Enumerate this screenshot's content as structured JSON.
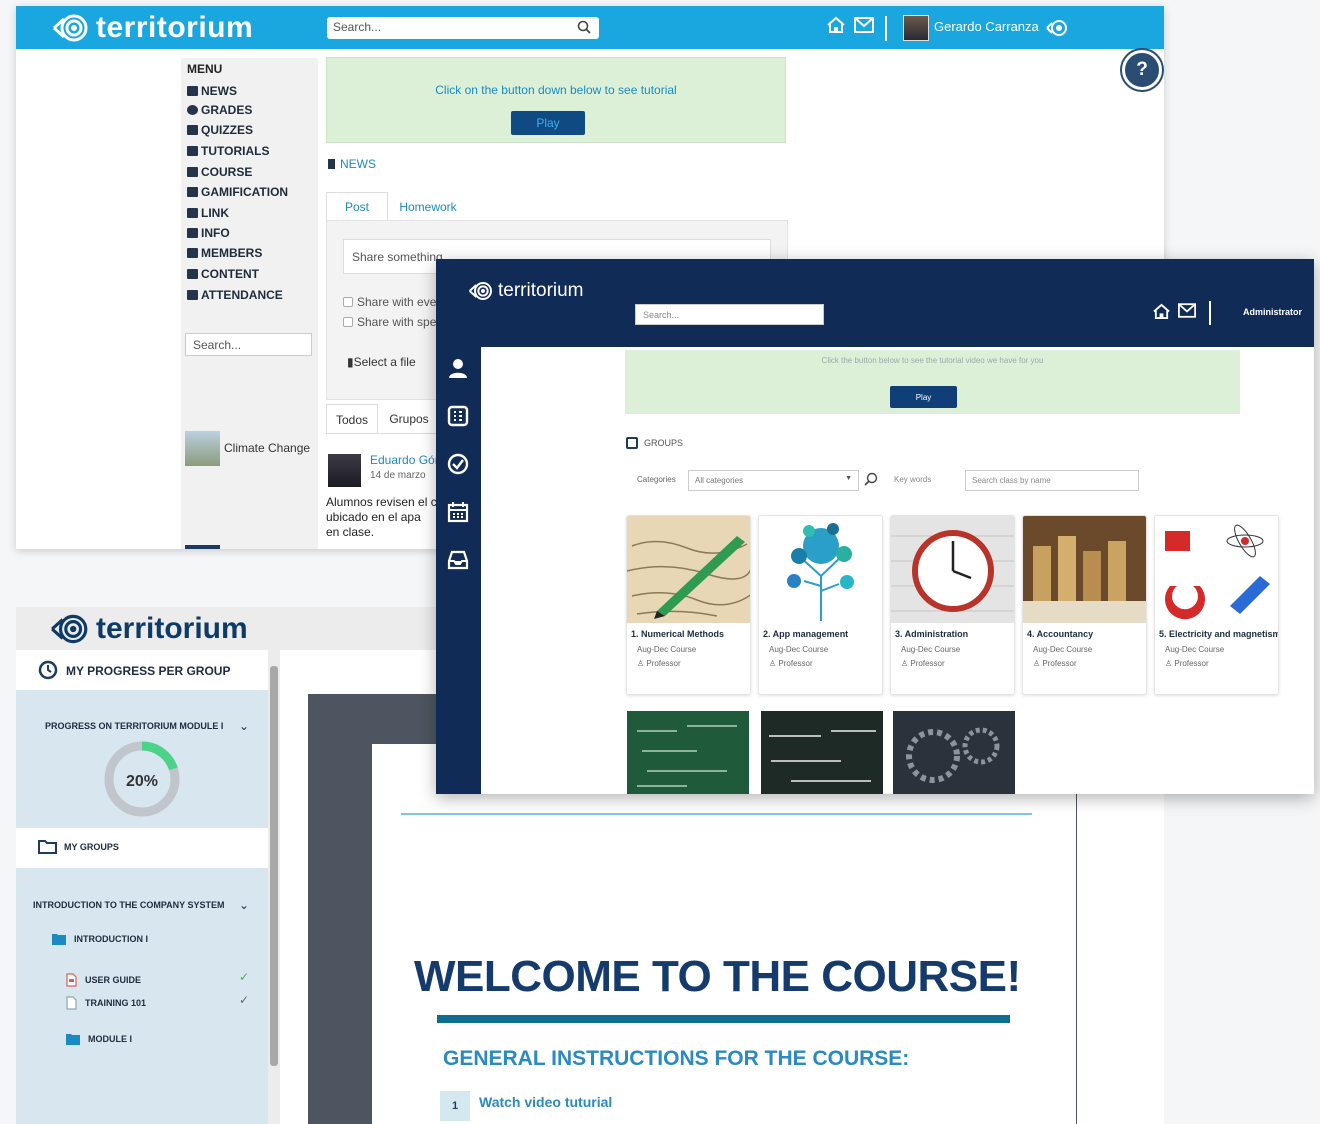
{
  "window_main": {
    "logo_text": "territorium",
    "search_placeholder": "Search...",
    "user_name": "Gerardo Carranza",
    "help_label": "?",
    "menu": {
      "title": "MENU",
      "items": [
        {
          "label": "NEWS",
          "icon": "newspaper-icon"
        },
        {
          "label": "GRADES",
          "icon": "check-circle-icon"
        },
        {
          "label": "QUIZZES",
          "icon": "bookmark-icon"
        },
        {
          "label": "TUTORIALS",
          "icon": "play-square-icon"
        },
        {
          "label": "COURSE",
          "icon": "book-icon"
        },
        {
          "label": "GAMIFICATION",
          "icon": "trophy-icon"
        },
        {
          "label": "LINK",
          "icon": "link-icon"
        },
        {
          "label": "INFO",
          "icon": "image-icon"
        },
        {
          "label": "MEMBERS",
          "icon": "members-icon"
        },
        {
          "label": "CONTENT",
          "icon": "content-icon"
        },
        {
          "label": "ATTENDANCE",
          "icon": "attendance-icon"
        }
      ],
      "search_placeholder": "Search...",
      "featured_label": "Climate Change"
    },
    "tutorial": {
      "text": "Click on the button down below to see tutorial",
      "button": "Play"
    },
    "news_heading": "NEWS",
    "tabs": [
      "Post",
      "Homework"
    ],
    "share_placeholder": "Share something",
    "share_options": [
      "Share with eve",
      "Share with spe"
    ],
    "file_label": "Select a file",
    "feed_tabs": [
      "Todos",
      "Grupos"
    ],
    "post": {
      "author": "Eduardo Gón",
      "date": "14 de marzo",
      "text_lines": [
        "Alumnos revisen el c",
        "ubicado en el apa",
        "en clase."
      ]
    }
  },
  "window_progress": {
    "logo_text": "territorium",
    "progress_heading": "MY PROGRESS PER GROUP",
    "module_title": "PROGRESS ON TERRITORIUM MODULE I",
    "progress_percent": 20,
    "progress_label": "20%",
    "groups_heading": "MY GROUPS",
    "course_title": "INTRODUCTION TO THE COMPANY SYSTEM",
    "intro_folder": "INTRODUCTION I",
    "files": [
      {
        "label": "USER GUIDE",
        "done": true,
        "check_color": "#4caf50"
      },
      {
        "label": "TRAINING 101",
        "done": true,
        "check_color": "#666666"
      }
    ],
    "module_folder": "MODULE I",
    "welcome_title": "WELCOME TO THE COURSE!",
    "instructions_heading": "GENERAL INSTRUCTIONS FOR THE COURSE:",
    "steps": [
      {
        "number": "1",
        "label": "Watch video tuturial"
      }
    ]
  },
  "window_groups": {
    "logo_text": "territorium",
    "search_placeholder": "Search...",
    "user_label": "Administrator",
    "tutorial": {
      "text": "Click the button below to see the tutorial video we have for you",
      "button": "Play"
    },
    "groups_heading": "GROUPS",
    "categories_label": "Categories",
    "categories_value": "All categories",
    "keywords_label": "Key words",
    "keywords_placeholder": "Search class by name",
    "courses": [
      {
        "title": "1. Numerical Methods",
        "subtitle": "Aug-Dec Course",
        "role": "Professor"
      },
      {
        "title": "2. App management",
        "subtitle": "Aug-Dec Course",
        "role": "Professor"
      },
      {
        "title": "3. Administration",
        "subtitle": "Aug-Dec Course",
        "role": "Professor"
      },
      {
        "title": "4. Accountancy",
        "subtitle": "Aug-Dec Course",
        "role": "Professor"
      },
      {
        "title": "5. Electricity and magnetism",
        "subtitle": "Aug-Dec Course",
        "role": "Professor"
      }
    ],
    "rail_icons": [
      "user-icon",
      "grades-icon",
      "check-icon",
      "calendar-icon",
      "inbox-icon"
    ]
  },
  "colors": {
    "main_header": "#1aa6de",
    "navy_header": "#0f2b56",
    "tutorial_bg": "#dcf0d8",
    "accent_blue": "#1a8ac2",
    "progress_green": "#4cd38a"
  }
}
